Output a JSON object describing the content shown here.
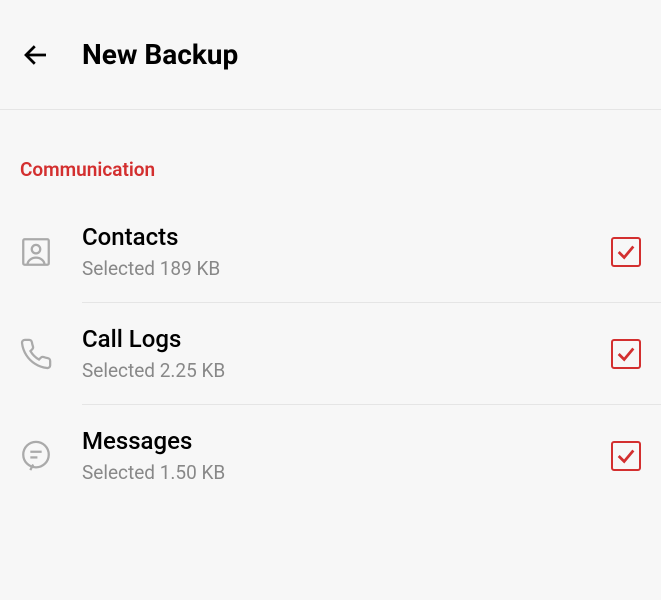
{
  "header": {
    "title": "New Backup"
  },
  "section": {
    "label": "Communication"
  },
  "items": [
    {
      "title": "Contacts",
      "subtitle": "Selected 189 KB",
      "icon": "contacts"
    },
    {
      "title": "Call Logs",
      "subtitle": "Selected 2.25 KB",
      "icon": "phone"
    },
    {
      "title": "Messages",
      "subtitle": "Selected 1.50 KB",
      "icon": "message"
    }
  ]
}
